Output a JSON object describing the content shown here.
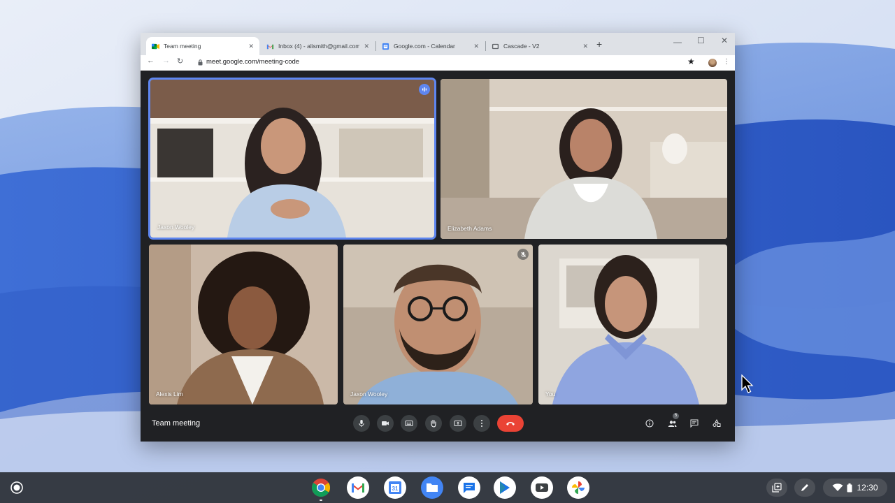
{
  "browser": {
    "tabs": [
      {
        "label": "Team meeting",
        "icon": "meet-icon",
        "active": true
      },
      {
        "label": "Inbox (4) - alismith@gmail.com",
        "icon": "gmail-icon",
        "active": false
      },
      {
        "label": "Google.com - Calendar",
        "icon": "calendar-icon",
        "active": false
      },
      {
        "label": "Cascade - V2",
        "icon": "slides-icon",
        "active": false
      }
    ],
    "new_tab": "+",
    "close": "✕",
    "minimize": "—",
    "maximize": "☐",
    "window_close": "✕",
    "back": "←",
    "forward": "→",
    "reload": "↻",
    "url": "meet.google.com/meeting-code",
    "star": "★",
    "menu": "⋮"
  },
  "meeting": {
    "title": "Team meeting",
    "participants_count": "5",
    "tiles": [
      {
        "name": "Jaxon Wooley",
        "speaking": true,
        "muted": false
      },
      {
        "name": "Elizabeth Adams",
        "speaking": false,
        "muted": false
      },
      {
        "name": "Alexis Lim",
        "speaking": false,
        "muted": false
      },
      {
        "name": "Jaxon Wooley",
        "speaking": false,
        "muted": true
      },
      {
        "name": "You",
        "speaking": false,
        "muted": false
      }
    ],
    "controls": [
      "microphone-icon",
      "camera-icon",
      "captions-icon",
      "raise-hand-icon",
      "present-icon",
      "more-options-icon",
      "hang-up-icon"
    ],
    "right_controls": [
      "info-icon",
      "people-icon",
      "chat-icon",
      "activities-icon"
    ],
    "colors": {
      "accent": "#5e86f0",
      "hangup": "#ea4335",
      "background": "#202124"
    }
  },
  "shelf": {
    "apps": [
      "chrome-icon",
      "gmail-icon",
      "calendar-icon",
      "files-icon",
      "messages-icon",
      "play-store-icon",
      "youtube-icon",
      "photos-icon"
    ],
    "time": "12:30"
  }
}
